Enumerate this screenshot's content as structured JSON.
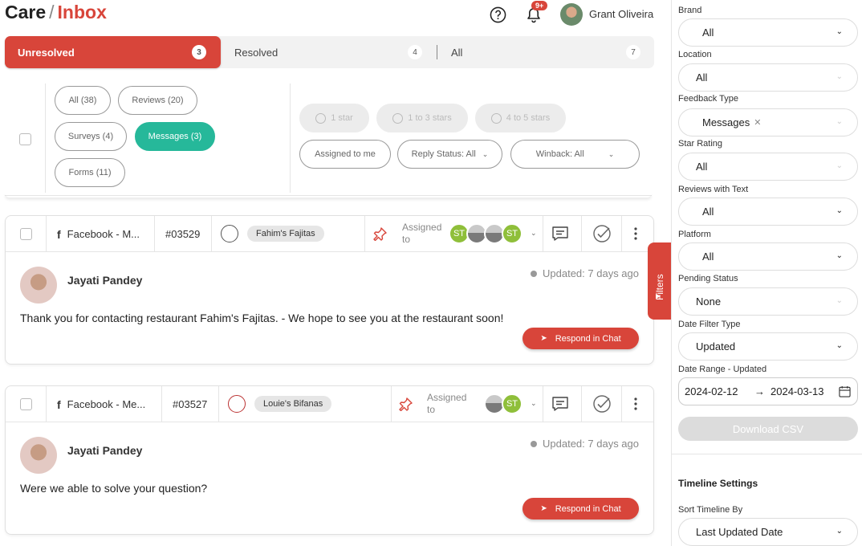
{
  "breadcrumb": {
    "root": "Care",
    "separator": "/",
    "current": "Inbox"
  },
  "header": {
    "notification_badge": "9+",
    "user_name": "Grant Oliveira"
  },
  "tabs": [
    {
      "label": "Unresolved",
      "count": "3",
      "active": true
    },
    {
      "label": "Resolved",
      "count": "4",
      "active": false
    },
    {
      "label": "All",
      "count": "7",
      "active": false
    }
  ],
  "type_filters": [
    {
      "label": "All (38)",
      "active": false
    },
    {
      "label": "Reviews (20)",
      "active": false
    },
    {
      "label": "Surveys (4)",
      "active": false
    },
    {
      "label": "Messages (3)",
      "active": true
    },
    {
      "label": "Forms (11)",
      "active": false
    }
  ],
  "star_filters": [
    "1 star",
    "1 to 3 stars",
    "4 to 5 stars"
  ],
  "extra_filters": {
    "assigned_to_me": "Assigned to me",
    "reply_status": "Reply Status: All",
    "winback": "Winback: All"
  },
  "filters_tab_label": "Filters",
  "conversations": [
    {
      "source": "Facebook - M...",
      "ticket_id": "#03529",
      "location": "Fahim's Fajitas",
      "assigned_label": "Assigned to",
      "assignees": [
        "ST",
        "",
        "",
        "ST"
      ],
      "author": "Jayati Pandey",
      "updated": "Updated: 7 days ago",
      "message": "Thank you for contacting restaurant Fahim's Fajitas. - We hope to see you at the restaurant soon!",
      "respond_label": "Respond in Chat"
    },
    {
      "source": "Facebook - Me...",
      "ticket_id": "#03527",
      "location": "Louie's Bifanas",
      "assigned_label": "Assigned to",
      "assignees": [
        "",
        "ST"
      ],
      "author": "Jayati Pandey",
      "updated": "Updated: 7 days ago",
      "message": "Were we able to solve your question?",
      "respond_label": "Respond in Chat"
    }
  ],
  "filter_panel": {
    "brand": {
      "label": "Brand",
      "value": "All"
    },
    "location": {
      "label": "Location",
      "value": "All"
    },
    "feedback_type": {
      "label": "Feedback Type",
      "value": "Messages"
    },
    "star_rating": {
      "label": "Star Rating",
      "value": "All"
    },
    "reviews_with_text": {
      "label": "Reviews with Text",
      "value": "All"
    },
    "platform": {
      "label": "Platform",
      "value": "All"
    },
    "pending_status": {
      "label": "Pending Status",
      "value": "None"
    },
    "date_filter_type": {
      "label": "Date Filter Type",
      "value": "Updated"
    },
    "date_range": {
      "label": "Date Range - Updated",
      "start": "2024-02-12",
      "arrow": "→",
      "end": "2024-03-13"
    },
    "download_label": "Download CSV",
    "timeline_title": "Timeline Settings",
    "sort_timeline": {
      "label": "Sort Timeline By",
      "value": "Last Updated Date"
    }
  },
  "colors": {
    "brand_red": "#d8453a",
    "active_green": "#26b89a",
    "assignee_green": "#8fbf3a"
  },
  "icons": [
    "help-icon",
    "bell-icon",
    "facebook-icon",
    "pin-icon",
    "chat-icon",
    "check-circle-icon",
    "more-vertical-icon",
    "clock-icon",
    "send-icon",
    "calendar-icon",
    "chevron-down-icon",
    "close-icon",
    "smiley-icon"
  ]
}
